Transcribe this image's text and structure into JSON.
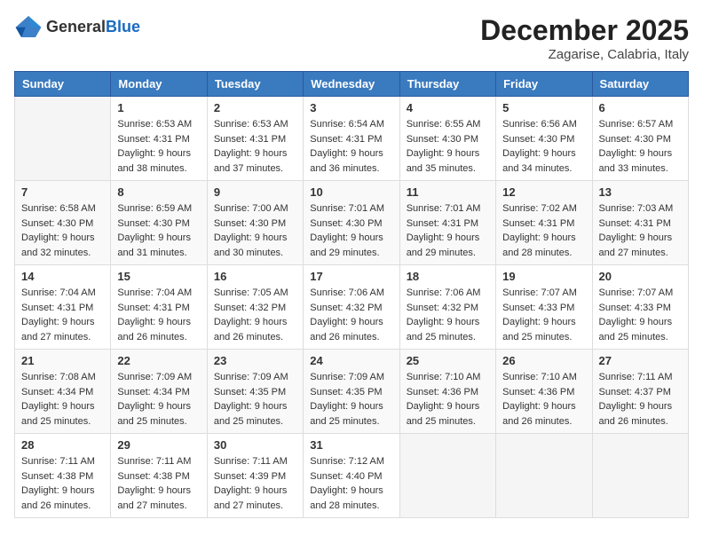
{
  "logo": {
    "text_general": "General",
    "text_blue": "Blue"
  },
  "header": {
    "month_title": "December 2025",
    "location": "Zagarise, Calabria, Italy"
  },
  "days_of_week": [
    "Sunday",
    "Monday",
    "Tuesday",
    "Wednesday",
    "Thursday",
    "Friday",
    "Saturday"
  ],
  "weeks": [
    [
      {
        "day": "",
        "sunrise": "",
        "sunset": "",
        "daylight": ""
      },
      {
        "day": "1",
        "sunrise": "Sunrise: 6:53 AM",
        "sunset": "Sunset: 4:31 PM",
        "daylight": "Daylight: 9 hours and 38 minutes."
      },
      {
        "day": "2",
        "sunrise": "Sunrise: 6:53 AM",
        "sunset": "Sunset: 4:31 PM",
        "daylight": "Daylight: 9 hours and 37 minutes."
      },
      {
        "day": "3",
        "sunrise": "Sunrise: 6:54 AM",
        "sunset": "Sunset: 4:31 PM",
        "daylight": "Daylight: 9 hours and 36 minutes."
      },
      {
        "day": "4",
        "sunrise": "Sunrise: 6:55 AM",
        "sunset": "Sunset: 4:30 PM",
        "daylight": "Daylight: 9 hours and 35 minutes."
      },
      {
        "day": "5",
        "sunrise": "Sunrise: 6:56 AM",
        "sunset": "Sunset: 4:30 PM",
        "daylight": "Daylight: 9 hours and 34 minutes."
      },
      {
        "day": "6",
        "sunrise": "Sunrise: 6:57 AM",
        "sunset": "Sunset: 4:30 PM",
        "daylight": "Daylight: 9 hours and 33 minutes."
      }
    ],
    [
      {
        "day": "7",
        "sunrise": "Sunrise: 6:58 AM",
        "sunset": "Sunset: 4:30 PM",
        "daylight": "Daylight: 9 hours and 32 minutes."
      },
      {
        "day": "8",
        "sunrise": "Sunrise: 6:59 AM",
        "sunset": "Sunset: 4:30 PM",
        "daylight": "Daylight: 9 hours and 31 minutes."
      },
      {
        "day": "9",
        "sunrise": "Sunrise: 7:00 AM",
        "sunset": "Sunset: 4:30 PM",
        "daylight": "Daylight: 9 hours and 30 minutes."
      },
      {
        "day": "10",
        "sunrise": "Sunrise: 7:01 AM",
        "sunset": "Sunset: 4:30 PM",
        "daylight": "Daylight: 9 hours and 29 minutes."
      },
      {
        "day": "11",
        "sunrise": "Sunrise: 7:01 AM",
        "sunset": "Sunset: 4:31 PM",
        "daylight": "Daylight: 9 hours and 29 minutes."
      },
      {
        "day": "12",
        "sunrise": "Sunrise: 7:02 AM",
        "sunset": "Sunset: 4:31 PM",
        "daylight": "Daylight: 9 hours and 28 minutes."
      },
      {
        "day": "13",
        "sunrise": "Sunrise: 7:03 AM",
        "sunset": "Sunset: 4:31 PM",
        "daylight": "Daylight: 9 hours and 27 minutes."
      }
    ],
    [
      {
        "day": "14",
        "sunrise": "Sunrise: 7:04 AM",
        "sunset": "Sunset: 4:31 PM",
        "daylight": "Daylight: 9 hours and 27 minutes."
      },
      {
        "day": "15",
        "sunrise": "Sunrise: 7:04 AM",
        "sunset": "Sunset: 4:31 PM",
        "daylight": "Daylight: 9 hours and 26 minutes."
      },
      {
        "day": "16",
        "sunrise": "Sunrise: 7:05 AM",
        "sunset": "Sunset: 4:32 PM",
        "daylight": "Daylight: 9 hours and 26 minutes."
      },
      {
        "day": "17",
        "sunrise": "Sunrise: 7:06 AM",
        "sunset": "Sunset: 4:32 PM",
        "daylight": "Daylight: 9 hours and 26 minutes."
      },
      {
        "day": "18",
        "sunrise": "Sunrise: 7:06 AM",
        "sunset": "Sunset: 4:32 PM",
        "daylight": "Daylight: 9 hours and 25 minutes."
      },
      {
        "day": "19",
        "sunrise": "Sunrise: 7:07 AM",
        "sunset": "Sunset: 4:33 PM",
        "daylight": "Daylight: 9 hours and 25 minutes."
      },
      {
        "day": "20",
        "sunrise": "Sunrise: 7:07 AM",
        "sunset": "Sunset: 4:33 PM",
        "daylight": "Daylight: 9 hours and 25 minutes."
      }
    ],
    [
      {
        "day": "21",
        "sunrise": "Sunrise: 7:08 AM",
        "sunset": "Sunset: 4:34 PM",
        "daylight": "Daylight: 9 hours and 25 minutes."
      },
      {
        "day": "22",
        "sunrise": "Sunrise: 7:09 AM",
        "sunset": "Sunset: 4:34 PM",
        "daylight": "Daylight: 9 hours and 25 minutes."
      },
      {
        "day": "23",
        "sunrise": "Sunrise: 7:09 AM",
        "sunset": "Sunset: 4:35 PM",
        "daylight": "Daylight: 9 hours and 25 minutes."
      },
      {
        "day": "24",
        "sunrise": "Sunrise: 7:09 AM",
        "sunset": "Sunset: 4:35 PM",
        "daylight": "Daylight: 9 hours and 25 minutes."
      },
      {
        "day": "25",
        "sunrise": "Sunrise: 7:10 AM",
        "sunset": "Sunset: 4:36 PM",
        "daylight": "Daylight: 9 hours and 25 minutes."
      },
      {
        "day": "26",
        "sunrise": "Sunrise: 7:10 AM",
        "sunset": "Sunset: 4:36 PM",
        "daylight": "Daylight: 9 hours and 26 minutes."
      },
      {
        "day": "27",
        "sunrise": "Sunrise: 7:11 AM",
        "sunset": "Sunset: 4:37 PM",
        "daylight": "Daylight: 9 hours and 26 minutes."
      }
    ],
    [
      {
        "day": "28",
        "sunrise": "Sunrise: 7:11 AM",
        "sunset": "Sunset: 4:38 PM",
        "daylight": "Daylight: 9 hours and 26 minutes."
      },
      {
        "day": "29",
        "sunrise": "Sunrise: 7:11 AM",
        "sunset": "Sunset: 4:38 PM",
        "daylight": "Daylight: 9 hours and 27 minutes."
      },
      {
        "day": "30",
        "sunrise": "Sunrise: 7:11 AM",
        "sunset": "Sunset: 4:39 PM",
        "daylight": "Daylight: 9 hours and 27 minutes."
      },
      {
        "day": "31",
        "sunrise": "Sunrise: 7:12 AM",
        "sunset": "Sunset: 4:40 PM",
        "daylight": "Daylight: 9 hours and 28 minutes."
      },
      {
        "day": "",
        "sunrise": "",
        "sunset": "",
        "daylight": ""
      },
      {
        "day": "",
        "sunrise": "",
        "sunset": "",
        "daylight": ""
      },
      {
        "day": "",
        "sunrise": "",
        "sunset": "",
        "daylight": ""
      }
    ]
  ]
}
